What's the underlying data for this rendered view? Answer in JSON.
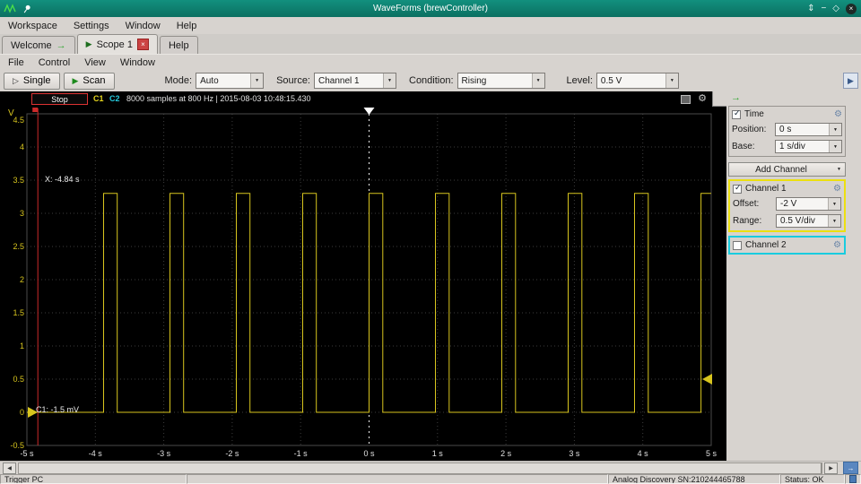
{
  "titlebar": {
    "title": "WaveForms  (brewController)"
  },
  "menubar": {
    "items": [
      "Workspace",
      "Settings",
      "Window",
      "Help"
    ]
  },
  "tabs": {
    "welcome": "Welcome",
    "scope": "Scope 1",
    "help": "Help"
  },
  "scope_menu": {
    "items": [
      "File",
      "Control",
      "View",
      "Window"
    ]
  },
  "toolbar": {
    "single": "Single",
    "scan": "Scan",
    "mode_label": "Mode:",
    "mode_value": "Auto",
    "source_label": "Source:",
    "source_value": "Channel 1",
    "condition_label": "Condition:",
    "condition_value": "Rising",
    "level_label": "Level:",
    "level_value": "0.5 V"
  },
  "plot_header": {
    "stop": "Stop",
    "c1": "C1",
    "c2": "C2",
    "info": "8000 samples at 800 Hz | 2015-08-03 10:48:15.430"
  },
  "plot": {
    "y_unit": "V",
    "x_cursor_label": "X: -4.84 s",
    "c1_readout": "C1: -1.5 mV"
  },
  "right_panel": {
    "time": {
      "label": "Time",
      "position_label": "Position:",
      "position_value": "0 s",
      "base_label": "Base:",
      "base_value": "1 s/div"
    },
    "add_channel": "Add Channel",
    "channel1": {
      "label": "Channel 1",
      "offset_label": "Offset:",
      "offset_value": "-2 V",
      "range_label": "Range:",
      "range_value": "0.5 V/div"
    },
    "channel2": {
      "label": "Channel 2"
    }
  },
  "statusbar": {
    "trigger": "Trigger PC",
    "device": "Analog Discovery SN:210244465788",
    "status": "Status: OK"
  },
  "icons": {
    "gear": "⚙",
    "chevron_down": "▼",
    "play": "▶",
    "single": "▷",
    "arrow_right": "→",
    "close": "×",
    "minimize": "−",
    "maximize": "◇",
    "restore": "⇕",
    "left_arrow": "◀",
    "right_arrow": "▶"
  },
  "chart_data": {
    "type": "line",
    "title": "",
    "y_unit": "V",
    "x_range": [
      -5,
      5
    ],
    "y_range": [
      -0.5,
      4.5
    ],
    "x_ticks": [
      -5,
      -4,
      -3,
      -2,
      -1,
      0,
      1,
      2,
      3,
      4,
      5
    ],
    "x_tick_labels": [
      "-5 s",
      "-4 s",
      "-3 s",
      "-2 s",
      "-1 s",
      "0 s",
      "1 s",
      "2 s",
      "3 s",
      "4 s",
      "5 s"
    ],
    "y_ticks": [
      4.5,
      4,
      3.5,
      3,
      2.5,
      2,
      1.5,
      1,
      0.5,
      0,
      -0.5
    ],
    "y_tick_labels": [
      "4.5",
      "4",
      "3.5",
      "3",
      "2.5",
      "2",
      "1.5",
      "1",
      "0.5",
      "0",
      "-0.5"
    ],
    "grid": true,
    "series": [
      {
        "name": "Channel 1",
        "waveform": "square-pulse",
        "low_v": 0,
        "high_v": 3.3,
        "pulse_width_s": 0.2,
        "period_s": 0.97,
        "rising_edges_s": [
          -3.88,
          -2.91,
          -1.94,
          -0.97,
          0,
          0.97,
          1.94,
          2.91,
          3.88,
          4.85
        ]
      }
    ],
    "cursors": {
      "x_cursor_s": -4.84,
      "trigger_time_s": 0,
      "trigger_level_v": 0.5,
      "channel1_zero_v": 0
    },
    "colors": {
      "background": "#000000",
      "grid": "#3c3c3c",
      "channel1": "#d8c51e",
      "channel2": "#22c8dc",
      "cursor": "#cc2a2a",
      "trigger": "#f0f0f0"
    }
  }
}
